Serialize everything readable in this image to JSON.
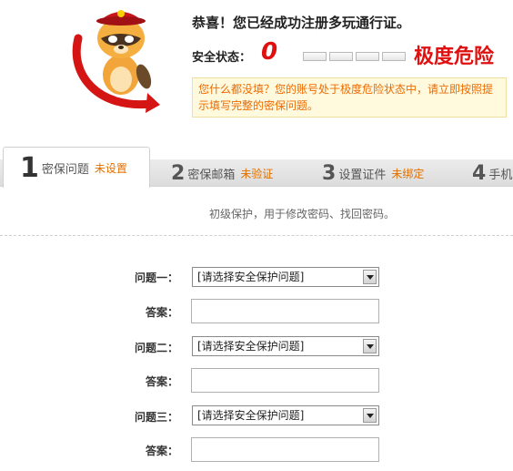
{
  "header": {
    "congrats": "恭喜！您已经成功注册多玩通行证。",
    "security_label": "安全状态：",
    "security_score": "0",
    "security_level": "极度危险",
    "warning": "您什么都没填？您的账号处于极度危险状态中，请立即按照提示填写完整的密保问题。"
  },
  "tabs": [
    {
      "num": "1",
      "name": "密保问题",
      "status": "未设置"
    },
    {
      "num": "2",
      "name": "密保邮箱",
      "status": "未验证"
    },
    {
      "num": "3",
      "name": "设置证件",
      "status": "未绑定"
    },
    {
      "num": "4",
      "name": "手机",
      "status": ""
    }
  ],
  "intro": "初级保护，用于修改密码、找回密码。",
  "form": {
    "q1_label": "问题一：",
    "q2_label": "问题二：",
    "q3_label": "问题三：",
    "answer_label": "答案：",
    "select_placeholder": "[请选择安全保护问题]",
    "answer1_value": "",
    "answer2_value": "",
    "answer3_value": ""
  },
  "colors": {
    "danger": "#e01010",
    "warning_text": "#ee6a00",
    "status": "#e07000"
  }
}
